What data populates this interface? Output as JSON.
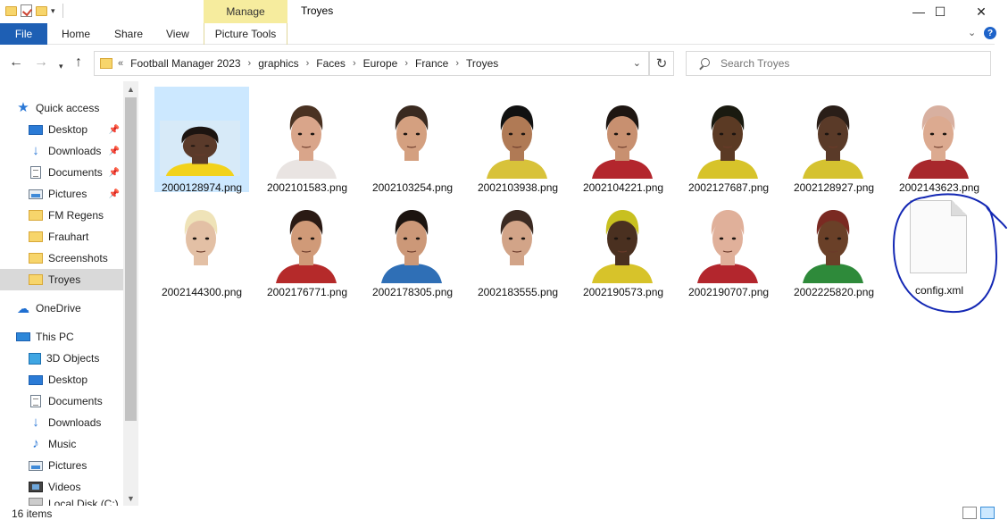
{
  "window": {
    "title": "Troyes",
    "manage_label": "Manage",
    "minimize": "—",
    "maximize": "☐",
    "close": "✕"
  },
  "ribbon": {
    "file": "File",
    "tabs": [
      "Home",
      "Share",
      "View"
    ],
    "picture_tools": "Picture Tools"
  },
  "address": {
    "crumbs": [
      "Football Manager 2023",
      "graphics",
      "Faces",
      "Europe",
      "France",
      "Troyes"
    ],
    "search_placeholder": "Search Troyes"
  },
  "sidebar": {
    "quick_access": "Quick access",
    "quick_items": [
      "Desktop",
      "Downloads",
      "Documents",
      "Pictures",
      "FM Regens",
      "Frauhart",
      "Screenshots",
      "Troyes"
    ],
    "onedrive": "OneDrive",
    "this_pc": "This PC",
    "pc_items": [
      "3D Objects",
      "Desktop",
      "Documents",
      "Downloads",
      "Music",
      "Pictures",
      "Videos",
      "Local Disk (C:)"
    ]
  },
  "files": [
    {
      "name": "2000128974.png",
      "skin": "#5a3a2a",
      "hair": "#1c1410",
      "shirt": "#f2d21b",
      "selected": true
    },
    {
      "name": "2002101583.png",
      "skin": "#d9a58a",
      "hair": "#4a3222",
      "shirt": "#e9e4e2"
    },
    {
      "name": "2002103254.png",
      "skin": "#d4a080",
      "hair": "#3a2a20",
      "shirt": "#ffffff"
    },
    {
      "name": "2002103938.png",
      "skin": "#b07a55",
      "hair": "#111111",
      "shirt": "#d8c23a"
    },
    {
      "name": "2002104221.png",
      "skin": "#c89070",
      "hair": "#1e1612",
      "shirt": "#b3262d"
    },
    {
      "name": "2002127687.png",
      "skin": "#5b3a24",
      "hair": "#1a1a10",
      "shirt": "#d7c32a"
    },
    {
      "name": "2002128927.png",
      "skin": "#5a3a28",
      "hair": "#2a1e18",
      "shirt": "#d5c230"
    },
    {
      "name": "2002143623.png",
      "skin": "#dcaa90",
      "hair": "#d8b0a0",
      "shirt": "#a8282c"
    },
    {
      "name": "2002144300.png",
      "skin": "#e3c0a5",
      "hair": "#efe3b8",
      "shirt": "#ffffff"
    },
    {
      "name": "2002176771.png",
      "skin": "#d09a78",
      "hair": "#2a1a14",
      "shirt": "#b52a2a"
    },
    {
      "name": "2002178305.png",
      "skin": "#cc9878",
      "hair": "#1c1410",
      "shirt": "#2f6fb6"
    },
    {
      "name": "2002183555.png",
      "skin": "#d2a488",
      "hair": "#3b2a22",
      "shirt": "#ffffff"
    },
    {
      "name": "2002190573.png",
      "skin": "#4a3020",
      "hair": "#c8c020",
      "shirt": "#d7c32a"
    },
    {
      "name": "2002190707.png",
      "skin": "#e0b09a",
      "hair": "#e0b09a",
      "shirt": "#b3262d"
    },
    {
      "name": "2002225820.png",
      "skin": "#6a4028",
      "hair": "#7a2a22",
      "shirt": "#2e8a3a"
    },
    {
      "name": "config.xml",
      "type": "xml"
    }
  ],
  "status": {
    "item_count": "16 items"
  }
}
